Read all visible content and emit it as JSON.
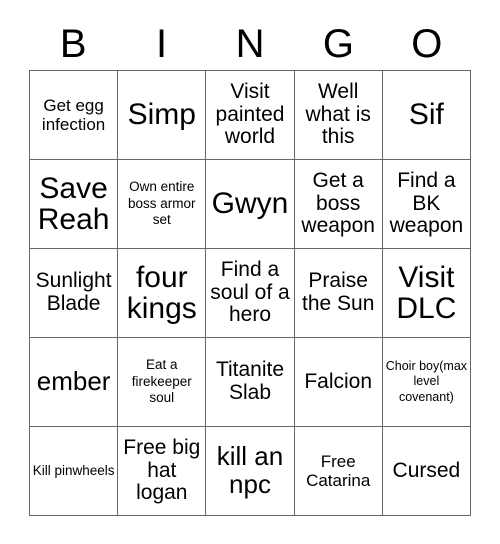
{
  "card": {
    "header_letters": [
      "B",
      "I",
      "N",
      "G",
      "O"
    ],
    "grid_size": "5x5",
    "colors": {
      "background": "#ffffff",
      "text": "#000000",
      "grid_line": "#666666"
    },
    "rows": [
      [
        {
          "text": "Get egg infection",
          "size": "fs-sm"
        },
        {
          "text": "Simp",
          "size": "fs-xl"
        },
        {
          "text": "Visit painted world",
          "size": "fs-md"
        },
        {
          "text": "Well what is this",
          "size": "fs-md"
        },
        {
          "text": "Sif",
          "size": "fs-xl"
        }
      ],
      [
        {
          "text": "Save Reah",
          "size": "fs-xl"
        },
        {
          "text": "Own entire boss armor set",
          "size": "fs-xs"
        },
        {
          "text": "Gwyn",
          "size": "fs-xl"
        },
        {
          "text": "Get a boss weapon",
          "size": "fs-md"
        },
        {
          "text": "Find a BK weapon",
          "size": "fs-md"
        }
      ],
      [
        {
          "text": "Sunlight Blade",
          "size": "fs-md"
        },
        {
          "text": "four kings",
          "size": "fs-xl"
        },
        {
          "text": "Find a soul of a hero",
          "size": "fs-md"
        },
        {
          "text": "Praise the Sun",
          "size": "fs-md"
        },
        {
          "text": "Visit DLC",
          "size": "fs-xl"
        }
      ],
      [
        {
          "text": "ember",
          "size": "fs-lg"
        },
        {
          "text": "Eat a firekeeper soul",
          "size": "fs-xs"
        },
        {
          "text": "Titanite Slab",
          "size": "fs-md"
        },
        {
          "text": "Falcion",
          "size": "fs-md"
        },
        {
          "text": "Choir boy(max level covenant)",
          "size": "fs-xxs"
        }
      ],
      [
        {
          "text": "Kill pinwheels",
          "size": "fs-xs"
        },
        {
          "text": "Free big hat logan",
          "size": "fs-md"
        },
        {
          "text": "kill an npc",
          "size": "fs-lg"
        },
        {
          "text": "Free Catarina",
          "size": "fs-sm"
        },
        {
          "text": "Cursed",
          "size": "fs-md"
        }
      ]
    ]
  }
}
